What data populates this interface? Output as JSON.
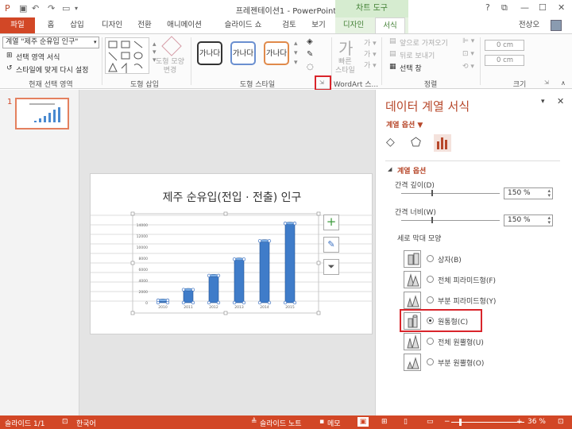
{
  "window": {
    "title": "프레젠테이션1 - PowerPoint",
    "contextual_tab_group": "차트 도구",
    "controls": [
      "?",
      "⧉",
      "—",
      "☐",
      "✕"
    ]
  },
  "tabs": [
    "파일",
    "홈",
    "삽입",
    "디자인",
    "전환",
    "애니메이션",
    "슬라이드 쇼",
    "검토",
    "보기",
    "디자인",
    "서식"
  ],
  "active_tab": "서식",
  "user": "전상오",
  "ribbon": {
    "selection_combo": "계열 \"제주 순유입 인구\"",
    "format_selection": "선택 영역 서식",
    "reset_to_match": "스타일에 맞게 다시 설정",
    "group_current_selection": "현재 선택 영역",
    "group_insert_shapes": "도형 삽입",
    "change_shape": "도형 모양\n변경",
    "style_samples": [
      "가나다",
      "가나다",
      "가나다"
    ],
    "group_shape_styles": "도형 스타일",
    "wordart_group": "WordArt 스...",
    "quick_styles": "빠른\n스타일",
    "bring_forward": "앞으로 가져오기",
    "send_backward": "뒤로 보내기",
    "selection_pane": "선택 창",
    "group_arrange": "정렬",
    "height": "0 cm",
    "width": "0 cm",
    "group_size": "크기"
  },
  "thumbnail": {
    "number": "1"
  },
  "slide": {
    "title": "제주 순유입(전입 · 전출) 인구"
  },
  "chart_data": {
    "type": "bar",
    "categories": [
      "2010",
      "2011",
      "2012",
      "2013",
      "2014",
      "2015"
    ],
    "values": [
      437,
      2343,
      4876,
      7823,
      11112,
      14257
    ],
    "yticks": [
      "0",
      "2000",
      "4000",
      "6000",
      "8000",
      "10000",
      "12000",
      "14000"
    ],
    "ylim": [
      0,
      14000
    ],
    "title": "",
    "xlabel": "",
    "ylabel": ""
  },
  "pane": {
    "title": "데이터 계열 서식",
    "options_dropdown": "계열 옵션 ▼",
    "section": "계열 옵션",
    "gap_depth_label": "간격 깊이(D)",
    "gap_depth_value": "150 %",
    "gap_width_label": "간격 너비(W)",
    "gap_width_value": "150 %",
    "shape_label": "세로 막대 모양",
    "shapes": [
      "상자(B)",
      "전체 피라미드형(F)",
      "부분 피라미드형(Y)",
      "원통형(C)",
      "전체 원뿔형(U)",
      "부분 원뿔형(O)"
    ],
    "selected_shape": "원통형(C)"
  },
  "status": {
    "slide": "슬라이드 1/1",
    "language": "한국어",
    "notes": "슬라이드 노트",
    "comments": "메모",
    "zoom": "36 %"
  }
}
